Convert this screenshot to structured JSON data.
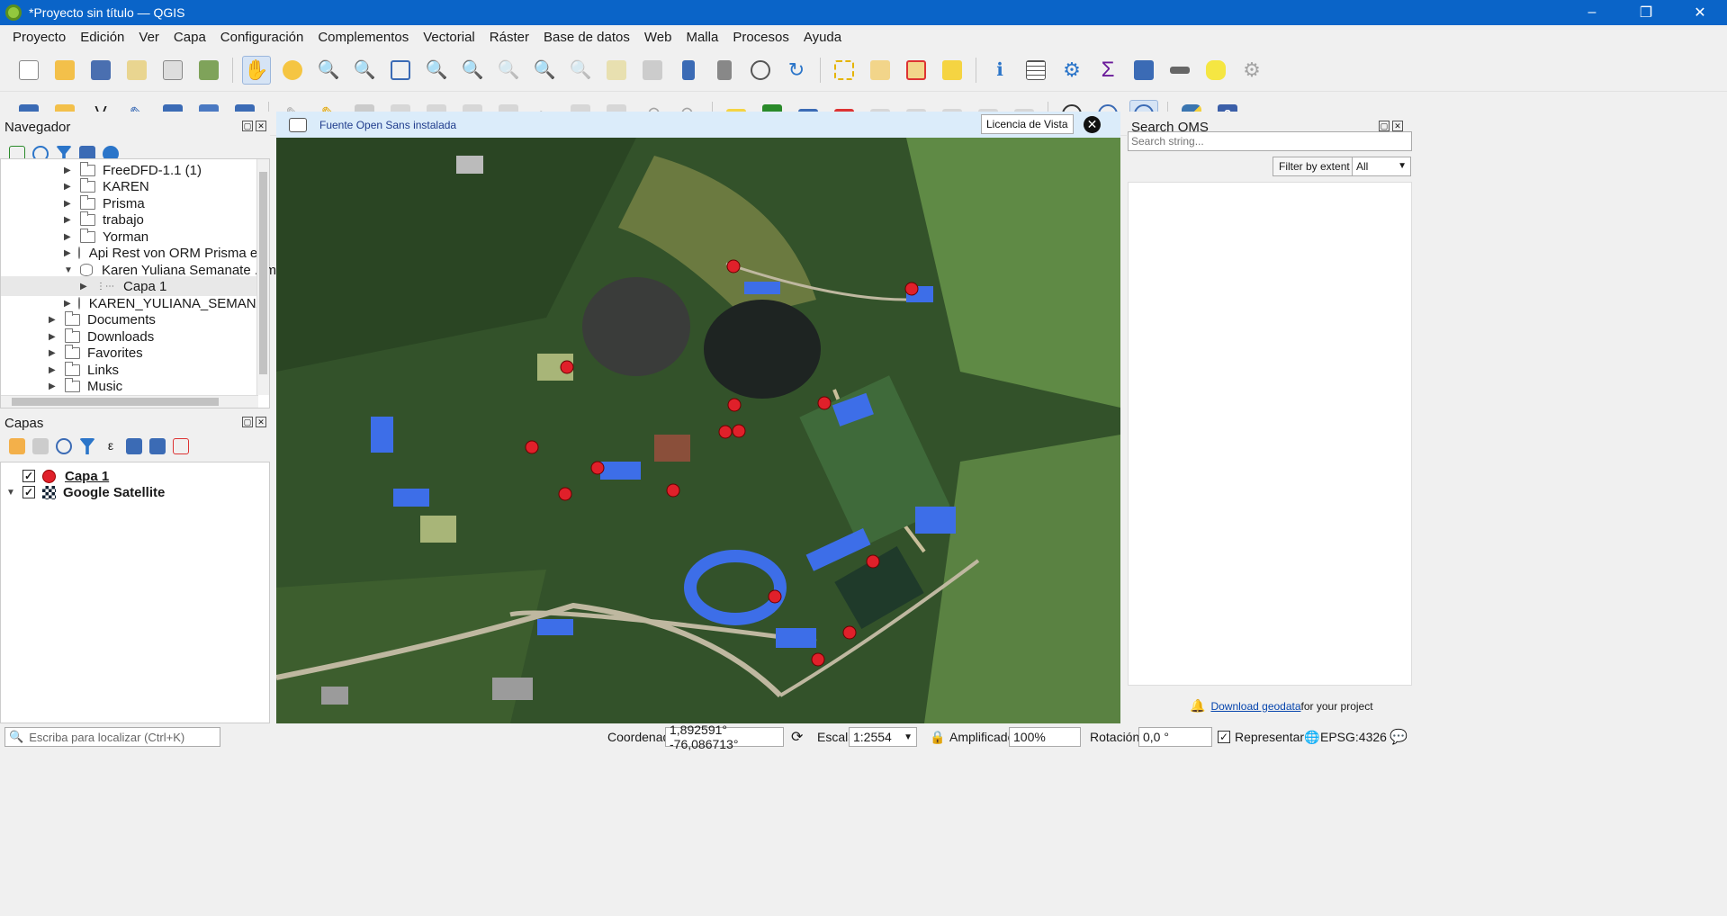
{
  "window": {
    "title": "*Proyecto sin título — QGIS"
  },
  "menu": [
    "Proyecto",
    "Edición",
    "Ver",
    "Capa",
    "Configuración",
    "Complementos",
    "Vectorial",
    "Ráster",
    "Base de datos",
    "Web",
    "Malla",
    "Procesos",
    "Ayuda"
  ],
  "browser": {
    "title": "Navegador",
    "items": [
      {
        "label": "FreeDFD-1.1 (1)",
        "type": "folder"
      },
      {
        "label": "KAREN",
        "type": "folder"
      },
      {
        "label": "Prisma",
        "type": "folder"
      },
      {
        "label": "trabajo",
        "type": "folder"
      },
      {
        "label": "Yorman",
        "type": "folder"
      },
      {
        "label": "Api Rest von ORM Prisma en el e",
        "type": "db"
      },
      {
        "label": "Karen Yuliana Semanate .kmz",
        "type": "db"
      },
      {
        "label": "Capa 1",
        "type": "points"
      },
      {
        "label": "KAREN_YULIANA_SEMANATE_BC",
        "type": "db"
      },
      {
        "label": "Documents",
        "type": "folder"
      },
      {
        "label": "Downloads",
        "type": "folder"
      },
      {
        "label": "Favorites",
        "type": "folder"
      },
      {
        "label": "Links",
        "type": "folder"
      },
      {
        "label": "Music",
        "type": "folder"
      }
    ]
  },
  "layers": {
    "title": "Capas",
    "items": [
      {
        "label": "Capa 1",
        "checked": "✓"
      },
      {
        "label": "Google Satellite",
        "checked": "✓"
      }
    ]
  },
  "message": {
    "text": "Fuente Open Sans instalada",
    "license_button": "Licencia de Vista",
    "close": "✕"
  },
  "qms": {
    "title": "Search QMS",
    "placeholder": "Search string...",
    "filter_button": "Filter by extent",
    "filter_select": "All",
    "download_link": "Download geodata",
    "download_suffix": " for your project"
  },
  "status": {
    "locate_placeholder": "Escriba para localizar (Ctrl+K)",
    "coord_label": "Coordenada",
    "coord_value": "1,892591° -76,086713°",
    "scale_label": "Escala",
    "scale_value": "1:2554",
    "magnifier_label": "Amplificador",
    "magnifier_value": "100%",
    "rotation_label": "Rotación",
    "rotation_value": "0,0 °",
    "render_label": "Representar",
    "crs": "EPSG:4326"
  },
  "colors": {
    "accent": "#0a64c8",
    "point": "#e0202a",
    "roof": "#2a5bd8"
  }
}
